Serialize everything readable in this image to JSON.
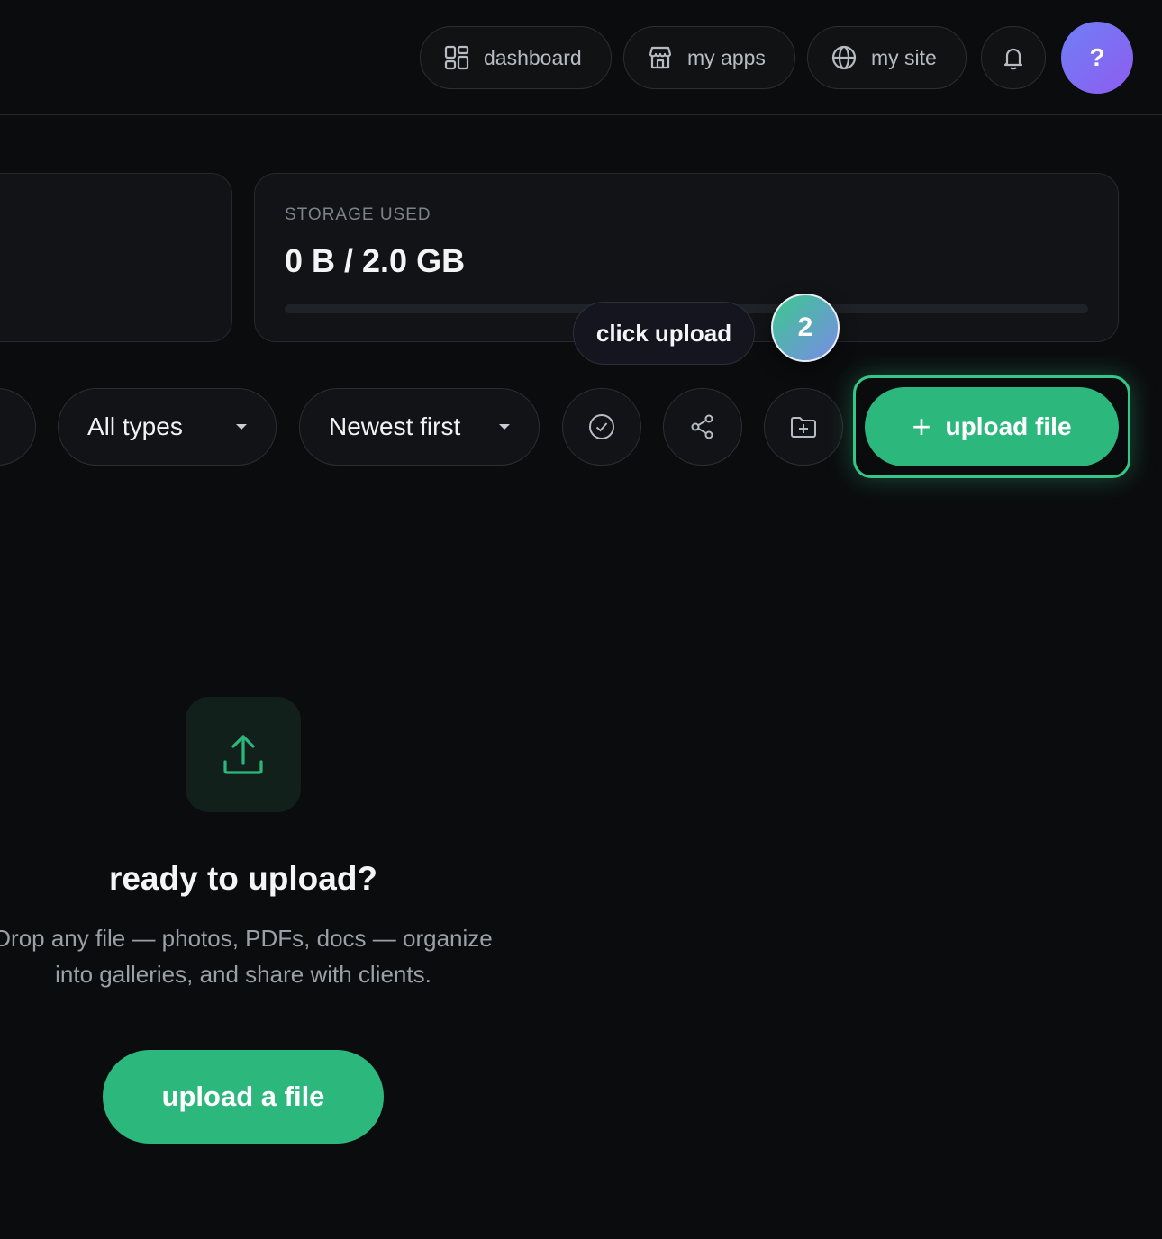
{
  "nav": {
    "dashboard_label": "dashboard",
    "apps_label": "my apps",
    "site_label": "my site",
    "avatar_initial": "?"
  },
  "storage": {
    "label": "STORAGE USED",
    "value": "0 B / 2.0 GB",
    "used_fraction": 0
  },
  "tour": {
    "tooltip": "click upload",
    "step": "2"
  },
  "toolbar": {
    "type_filter": "All types",
    "sort": "Newest first",
    "upload_label": "upload file"
  },
  "empty_state": {
    "title": "ready to upload?",
    "description_line1": "Drop any file — photos, PDFs, docs — organize",
    "description_line2": "into galleries, and share with clients.",
    "button": "upload a file"
  },
  "icons": [
    "dashboard-icon",
    "store-icon",
    "globe-icon",
    "bell-icon",
    "check-circle-icon",
    "share-icon",
    "folder-plus-icon",
    "plus-icon",
    "upload-icon",
    "chevron-down-icon"
  ],
  "colors": {
    "accent": "#2cb87d",
    "background": "#0b0c0e",
    "avatar": "#7b6ef3"
  }
}
